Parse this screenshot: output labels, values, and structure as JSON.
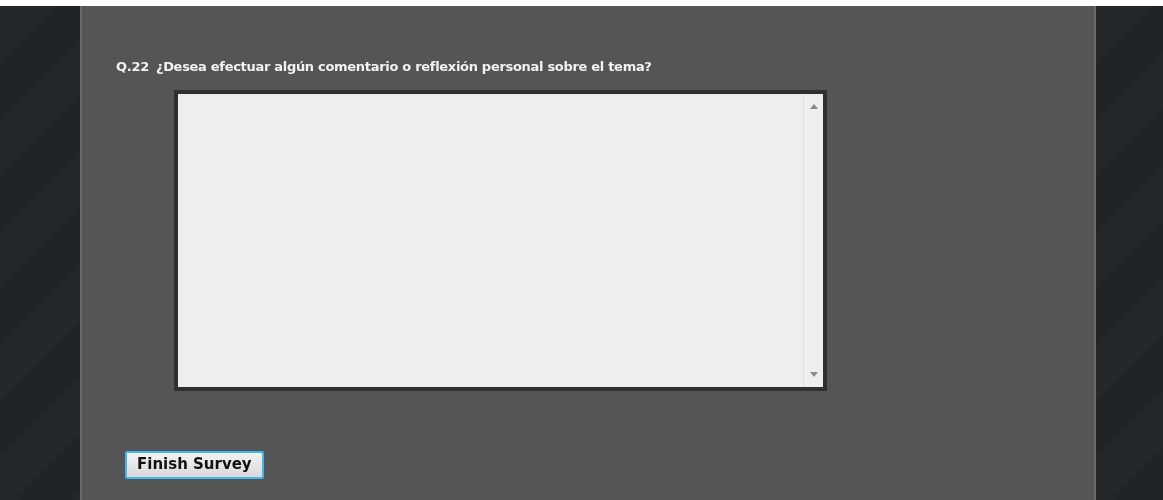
{
  "question": {
    "number": "Q.22",
    "text": "¿Desea efectuar algún comentario o reflexión personal sobre el tema?"
  },
  "submit_button": {
    "label": "Finish Survey"
  }
}
